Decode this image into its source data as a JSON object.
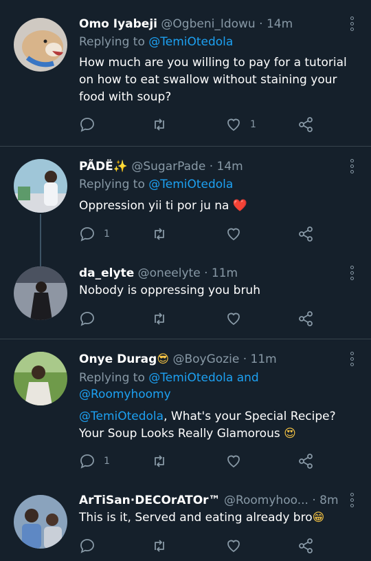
{
  "colors": {
    "background": "#15202b",
    "link": "#1da1f2",
    "muted": "#8899a6",
    "divider": "#38444d"
  },
  "tweets": [
    {
      "name": "Omo Iyabeji",
      "handle": "@Ogbeni_Idowu",
      "dot": "·",
      "time": "14m",
      "replying_prefix": "Replying to",
      "replying_to": "@TemiOtedola",
      "text": "How much are you willing to pay for a tutorial on how to eat swallow without staining your food with soup?",
      "reply_count": "",
      "like_count": "1"
    },
    {
      "name": "PÃDË",
      "name_emoji": "✨",
      "handle": "@SugarPade",
      "dot": "·",
      "time": "14m",
      "replying_prefix": "Replying to",
      "replying_to": "@TemiOtedola",
      "text": "Oppression yii ti por ju na",
      "text_emoji": "❤️",
      "reply_count": "1",
      "like_count": ""
    },
    {
      "name": "da_elyte",
      "handle": "@oneelyte",
      "dot": "·",
      "time": "11m",
      "text": "Nobody is oppressing you bruh",
      "reply_count": "",
      "like_count": ""
    },
    {
      "name": "Onye Durag",
      "name_emoji": "😎",
      "handle": "@BoyGozie",
      "dot": "·",
      "time": "11m",
      "replying_prefix": "Replying to",
      "replying_to": "@TemiOtedola and @Roomyhoomy",
      "mention": "@TemiOtedola",
      "text": ", What's your Special Recipe? Your Soup Looks Really Glamorous",
      "text_emoji": "😍",
      "reply_count": "1",
      "like_count": ""
    },
    {
      "name": "ArTiSan·DECOrATOr™",
      "handle": "@Roomyhoo...",
      "dot": "·",
      "time": "8m",
      "text": "This is it, Served and eating already bro",
      "text_emoji": "😁",
      "reply_count": "",
      "like_count": ""
    }
  ]
}
